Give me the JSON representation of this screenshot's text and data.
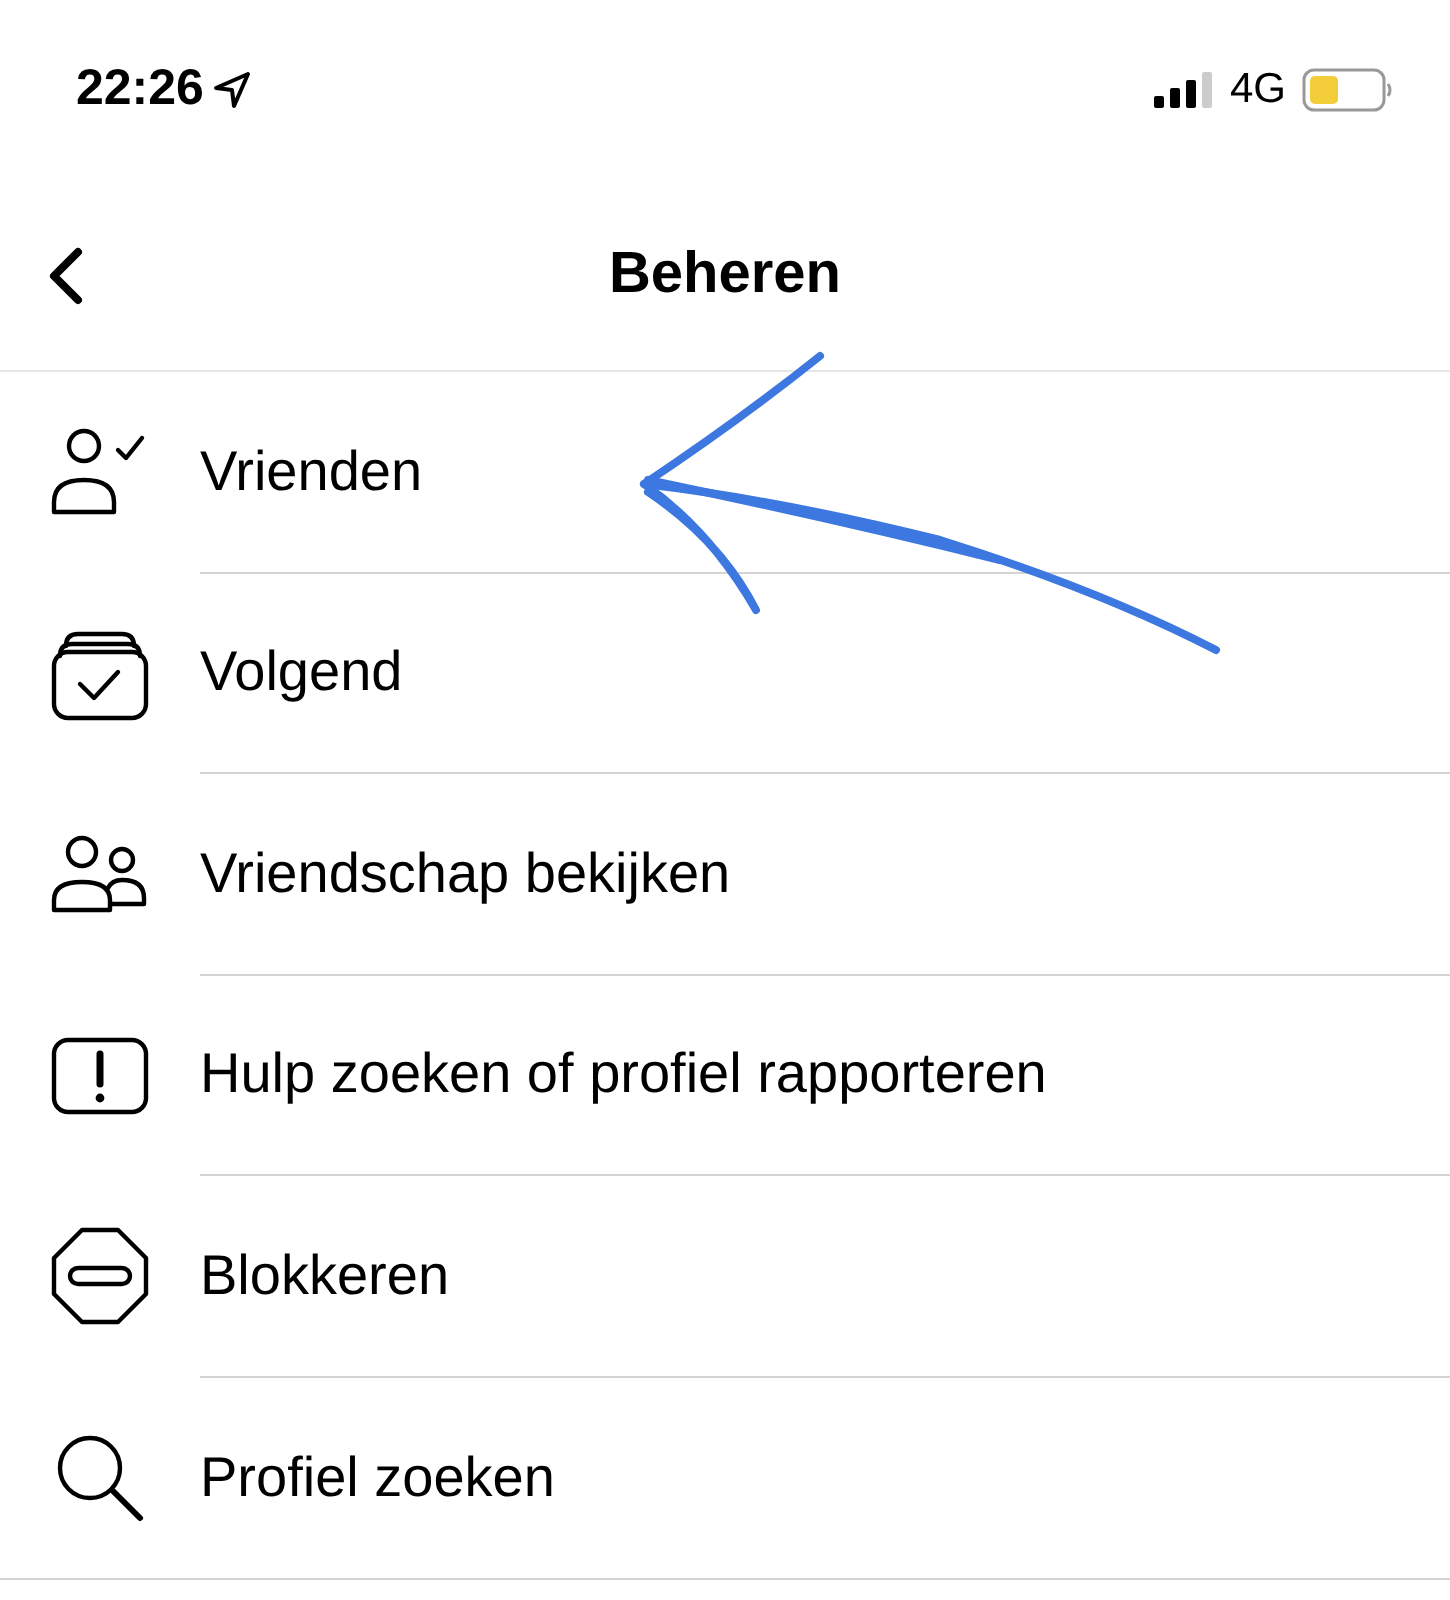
{
  "status_bar": {
    "time": "22:26",
    "network": "4G"
  },
  "header": {
    "title": "Beheren"
  },
  "menu": [
    {
      "label": "Vrienden"
    },
    {
      "label": "Volgend"
    },
    {
      "label": "Vriendschap bekijken"
    },
    {
      "label": "Hulp zoeken of profiel rapporteren"
    },
    {
      "label": "Blokkeren"
    },
    {
      "label": "Profiel zoeken"
    }
  ]
}
